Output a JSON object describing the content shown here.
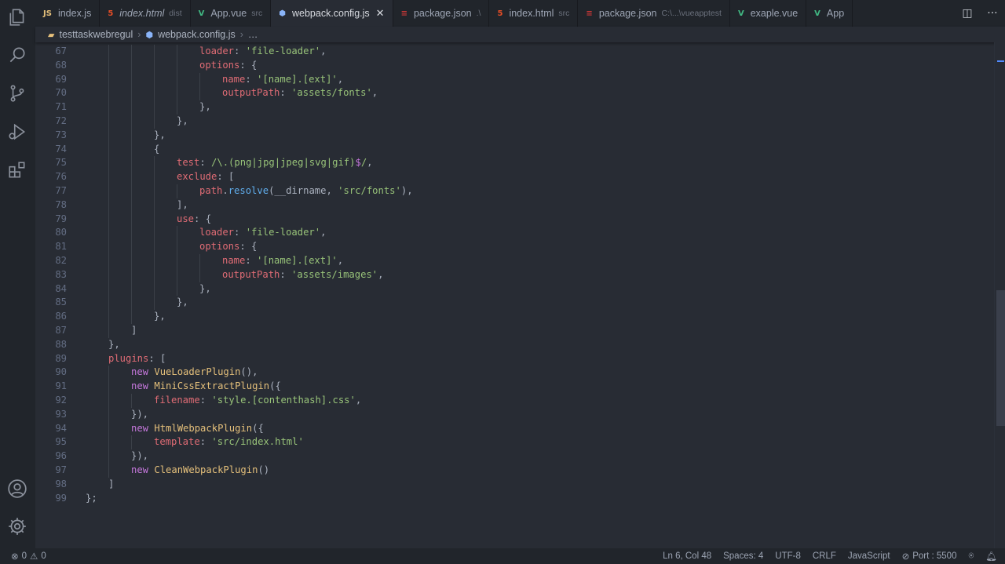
{
  "tabs": [
    {
      "icon": "JS",
      "icon_color": "#e5c07b",
      "label": "index.js",
      "desc": "",
      "italic": false,
      "active": false
    },
    {
      "icon": "5",
      "icon_color": "#e44d26",
      "label": "index.html",
      "desc": "dist",
      "italic": true,
      "active": false
    },
    {
      "icon": "V",
      "icon_color": "#41b883",
      "label": "App.vue",
      "desc": "src",
      "italic": false,
      "active": false
    },
    {
      "icon": "⬢",
      "icon_color": "#8ab4f8",
      "label": "webpack.config.js",
      "desc": "",
      "italic": false,
      "active": true
    },
    {
      "icon": "≡",
      "icon_color": "#cb3837",
      "label": "package.json",
      "desc": ".\\",
      "italic": false,
      "active": false
    },
    {
      "icon": "5",
      "icon_color": "#e44d26",
      "label": "index.html",
      "desc": "src",
      "italic": false,
      "active": false
    },
    {
      "icon": "≡",
      "icon_color": "#cb3837",
      "label": "package.json",
      "desc": "C:\\...\\vueapptest",
      "italic": false,
      "active": false
    },
    {
      "icon": "V",
      "icon_color": "#41b883",
      "label": "exaple.vue",
      "desc": "",
      "italic": false,
      "active": false
    },
    {
      "icon": "V",
      "icon_color": "#41b883",
      "label": "App",
      "desc": "",
      "italic": false,
      "active": false
    }
  ],
  "tab_close": "✕",
  "tab_actions": {
    "split": "◫",
    "more": "···"
  },
  "breadcrumb": {
    "folder": "testtaskwebregul",
    "file": "webpack.config.js",
    "sep": "›",
    "tail": "…"
  },
  "code_lines": [
    {
      "n": "67",
      "indent": 5,
      "tokens": [
        [
          "p",
          "loader"
        ],
        [
          "pn",
          ": "
        ],
        [
          "s",
          "'file-loader'"
        ],
        [
          "pn",
          ","
        ]
      ]
    },
    {
      "n": "68",
      "indent": 5,
      "tokens": [
        [
          "p",
          "options"
        ],
        [
          "pn",
          ": {"
        ]
      ]
    },
    {
      "n": "69",
      "indent": 6,
      "tokens": [
        [
          "p",
          "name"
        ],
        [
          "pn",
          ": "
        ],
        [
          "s",
          "'[name].[ext]'"
        ],
        [
          "pn",
          ","
        ]
      ]
    },
    {
      "n": "70",
      "indent": 6,
      "tokens": [
        [
          "p",
          "outputPath"
        ],
        [
          "pn",
          ": "
        ],
        [
          "s",
          "'assets/fonts'"
        ],
        [
          "pn",
          ","
        ]
      ]
    },
    {
      "n": "71",
      "indent": 5,
      "tokens": [
        [
          "pn",
          "},"
        ]
      ]
    },
    {
      "n": "72",
      "indent": 4,
      "tokens": [
        [
          "pn",
          "},"
        ]
      ]
    },
    {
      "n": "73",
      "indent": 3,
      "tokens": [
        [
          "pn",
          "},"
        ]
      ]
    },
    {
      "n": "74",
      "indent": 3,
      "tokens": [
        [
          "pn",
          "{"
        ]
      ]
    },
    {
      "n": "75",
      "indent": 4,
      "tokens": [
        [
          "p",
          "test"
        ],
        [
          "pn",
          ": "
        ],
        [
          "s",
          "/\\.(png|jpg|jpeg|svg|gif)"
        ],
        [
          "k",
          "$"
        ],
        [
          "s",
          "/"
        ],
        [
          "pn",
          ","
        ]
      ]
    },
    {
      "n": "76",
      "indent": 4,
      "tokens": [
        [
          "p",
          "exclude"
        ],
        [
          "pn",
          ": ["
        ]
      ]
    },
    {
      "n": "77",
      "indent": 5,
      "tokens": [
        [
          "p",
          "path"
        ],
        [
          "pn",
          "."
        ],
        [
          "f",
          "resolve"
        ],
        [
          "pn",
          "(__dirname, "
        ],
        [
          "s",
          "'src/fonts'"
        ],
        [
          "pn",
          "),"
        ]
      ]
    },
    {
      "n": "78",
      "indent": 4,
      "tokens": [
        [
          "pn",
          "],"
        ]
      ]
    },
    {
      "n": "79",
      "indent": 4,
      "tokens": [
        [
          "p",
          "use"
        ],
        [
          "pn",
          ": {"
        ]
      ]
    },
    {
      "n": "80",
      "indent": 5,
      "tokens": [
        [
          "p",
          "loader"
        ],
        [
          "pn",
          ": "
        ],
        [
          "s",
          "'file-loader'"
        ],
        [
          "pn",
          ","
        ]
      ]
    },
    {
      "n": "81",
      "indent": 5,
      "tokens": [
        [
          "p",
          "options"
        ],
        [
          "pn",
          ": {"
        ]
      ]
    },
    {
      "n": "82",
      "indent": 6,
      "tokens": [
        [
          "p",
          "name"
        ],
        [
          "pn",
          ": "
        ],
        [
          "s",
          "'[name].[ext]'"
        ],
        [
          "pn",
          ","
        ]
      ]
    },
    {
      "n": "83",
      "indent": 6,
      "tokens": [
        [
          "p",
          "outputPath"
        ],
        [
          "pn",
          ": "
        ],
        [
          "s",
          "'assets/images'"
        ],
        [
          "pn",
          ","
        ]
      ]
    },
    {
      "n": "84",
      "indent": 5,
      "tokens": [
        [
          "pn",
          "},"
        ]
      ]
    },
    {
      "n": "85",
      "indent": 4,
      "tokens": [
        [
          "pn",
          "},"
        ]
      ]
    },
    {
      "n": "86",
      "indent": 3,
      "tokens": [
        [
          "pn",
          "},"
        ]
      ]
    },
    {
      "n": "87",
      "indent": 2,
      "tokens": [
        [
          "pn",
          "]"
        ]
      ]
    },
    {
      "n": "88",
      "indent": 1,
      "tokens": [
        [
          "pn",
          "},"
        ]
      ]
    },
    {
      "n": "89",
      "indent": 1,
      "tokens": [
        [
          "p",
          "plugins"
        ],
        [
          "pn",
          ": ["
        ]
      ]
    },
    {
      "n": "90",
      "indent": 2,
      "tokens": [
        [
          "k",
          "new "
        ],
        [
          "c",
          "VueLoaderPlugin"
        ],
        [
          "pn",
          "(),"
        ]
      ]
    },
    {
      "n": "91",
      "indent": 2,
      "tokens": [
        [
          "k",
          "new "
        ],
        [
          "c",
          "MiniCssExtractPlugin"
        ],
        [
          "pn",
          "({"
        ]
      ]
    },
    {
      "n": "92",
      "indent": 3,
      "tokens": [
        [
          "p",
          "filename"
        ],
        [
          "pn",
          ": "
        ],
        [
          "s",
          "'style.[contenthash].css'"
        ],
        [
          "pn",
          ","
        ]
      ]
    },
    {
      "n": "93",
      "indent": 2,
      "tokens": [
        [
          "pn",
          "}),"
        ]
      ]
    },
    {
      "n": "94",
      "indent": 2,
      "tokens": [
        [
          "k",
          "new "
        ],
        [
          "c",
          "HtmlWebpackPlugin"
        ],
        [
          "pn",
          "({"
        ]
      ]
    },
    {
      "n": "95",
      "indent": 3,
      "tokens": [
        [
          "p",
          "template"
        ],
        [
          "pn",
          ": "
        ],
        [
          "s",
          "'src/index.html'"
        ]
      ]
    },
    {
      "n": "96",
      "indent": 2,
      "tokens": [
        [
          "pn",
          "}),"
        ]
      ]
    },
    {
      "n": "97",
      "indent": 2,
      "tokens": [
        [
          "k",
          "new "
        ],
        [
          "c",
          "CleanWebpackPlugin"
        ],
        [
          "pn",
          "()"
        ]
      ]
    },
    {
      "n": "98",
      "indent": 1,
      "tokens": [
        [
          "pn",
          "]"
        ]
      ]
    },
    {
      "n": "99",
      "indent": 0,
      "tokens": [
        [
          "pn",
          "};"
        ]
      ]
    }
  ],
  "status": {
    "errors": "0",
    "warnings": "0",
    "position": "Ln 6, Col 48",
    "spaces": "Spaces: 4",
    "encoding": "UTF-8",
    "eol": "CRLF",
    "language": "JavaScript",
    "port": "Port : 5500"
  },
  "colors": {
    "editor_bg": "#282c34",
    "chrome_bg": "#21252b",
    "property": "#e06c75",
    "string": "#98c379",
    "keyword": "#c678dd",
    "function": "#61afef",
    "class": "#e5c07b"
  }
}
